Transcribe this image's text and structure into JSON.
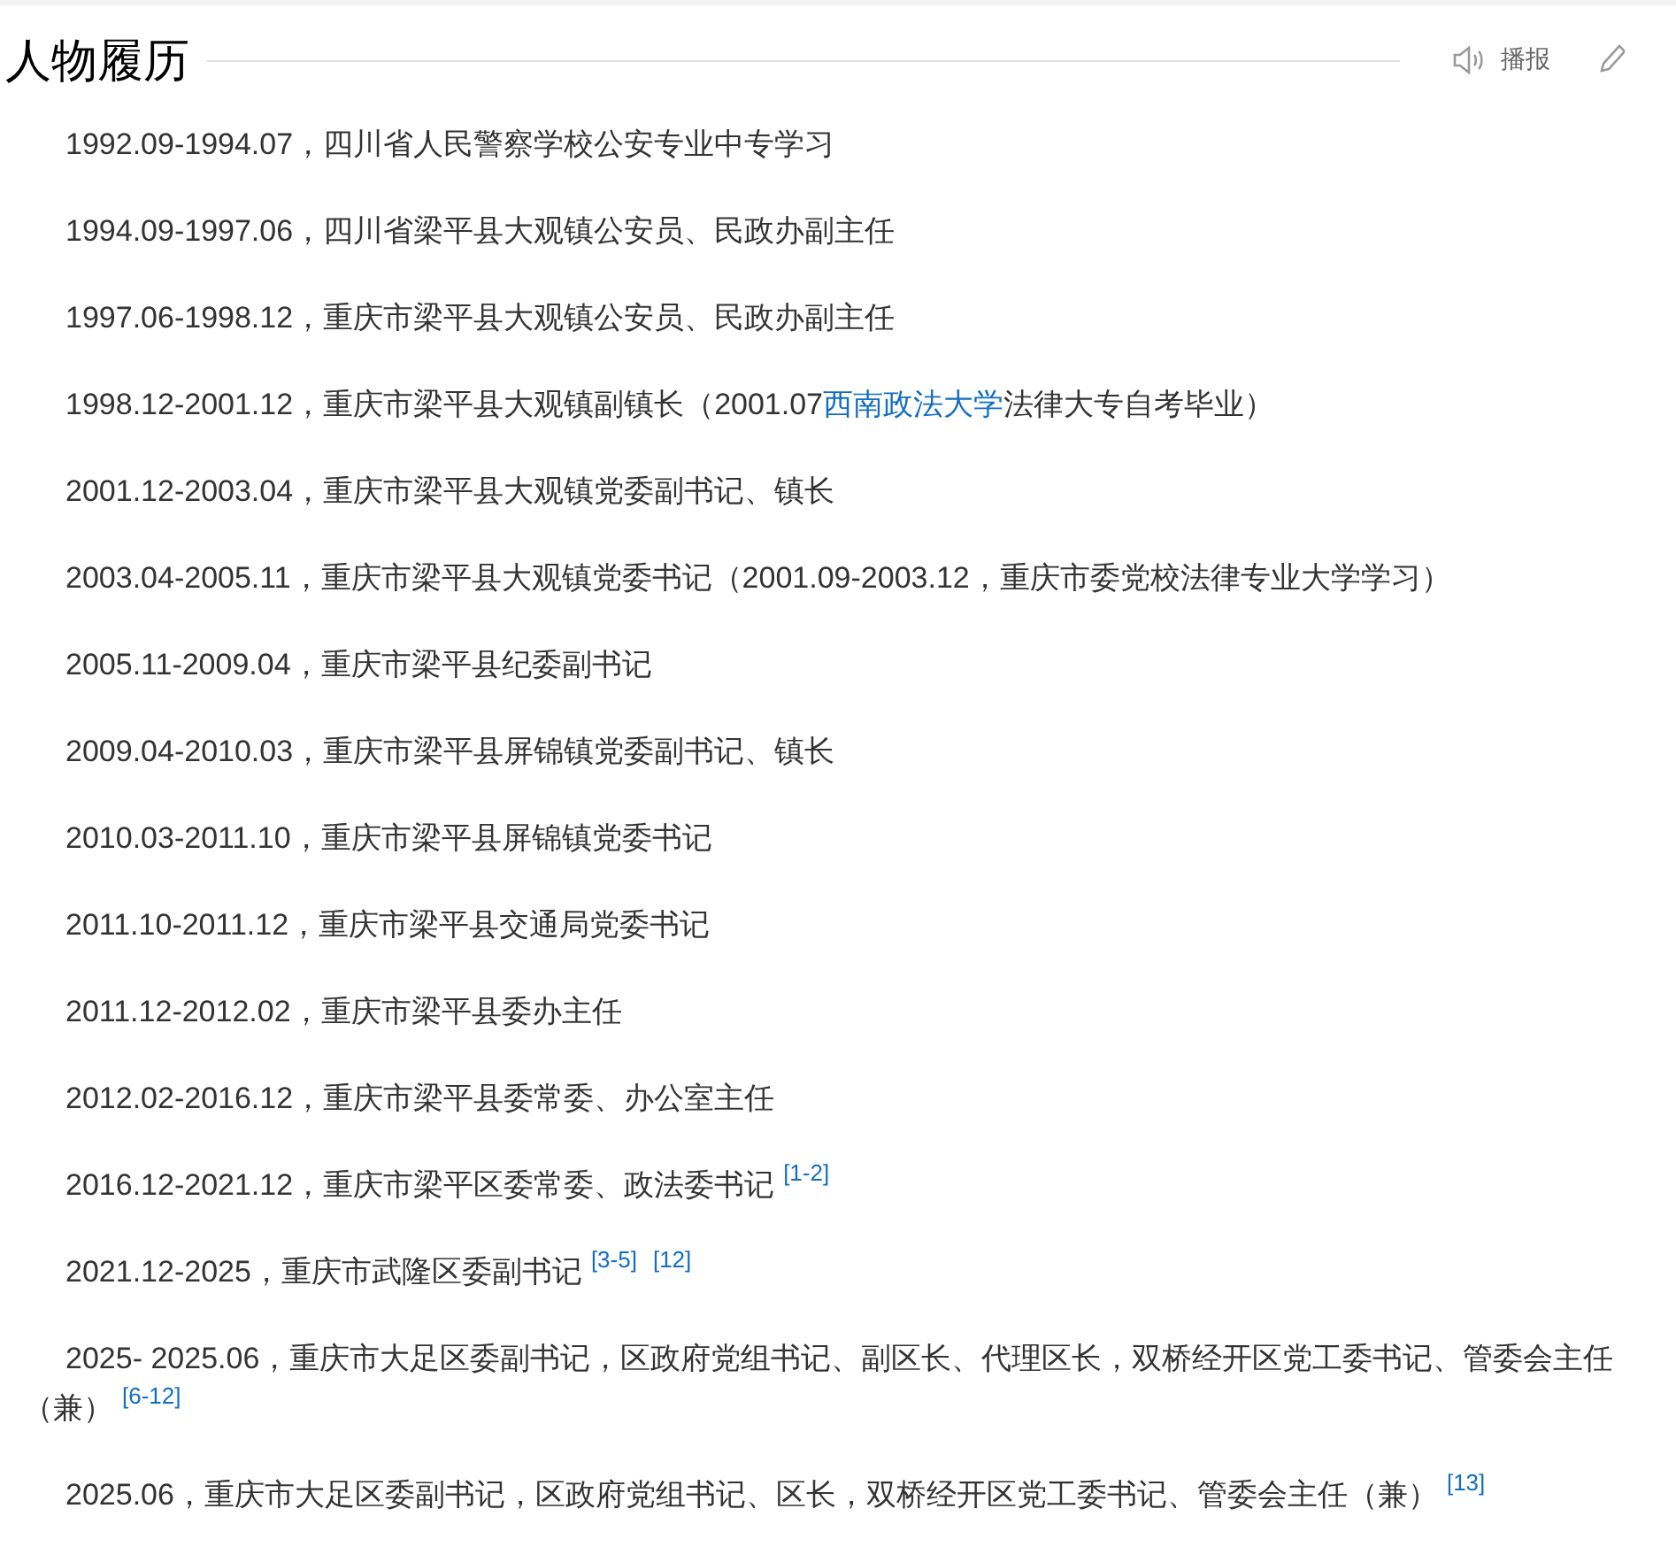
{
  "section": {
    "title": "人物履历",
    "actions": [
      {
        "kind": "speaker",
        "label": "播报"
      },
      {
        "kind": "edit"
      }
    ]
  },
  "paragraphs": [
    {
      "segments": [
        {
          "kind": "text",
          "text": "1992.09-1994.07，四川省人民警察学校公安专业中专学习"
        }
      ]
    },
    {
      "segments": [
        {
          "kind": "text",
          "text": "1994.09-1997.06，四川省梁平县大观镇公安员、民政办副主任"
        }
      ]
    },
    {
      "segments": [
        {
          "kind": "text",
          "text": "1997.06-1998.12，重庆市梁平县大观镇公安员、民政办副主任"
        }
      ]
    },
    {
      "segments": [
        {
          "kind": "text",
          "text": "1998.12-2001.12，重庆市梁平县大观镇副镇长（2001.07"
        },
        {
          "kind": "link",
          "text": "西南政法大学"
        },
        {
          "kind": "text",
          "text": "法律大专自考毕业）"
        }
      ]
    },
    {
      "segments": [
        {
          "kind": "text",
          "text": "2001.12-2003.04，重庆市梁平县大观镇党委副书记、镇长"
        }
      ]
    },
    {
      "segments": [
        {
          "kind": "text",
          "text": "2003.04-2005.11，重庆市梁平县大观镇党委书记（2001.09-2003.12，重庆市委党校法律专业大学学习）"
        }
      ]
    },
    {
      "segments": [
        {
          "kind": "text",
          "text": "2005.11-2009.04，重庆市梁平县纪委副书记"
        }
      ]
    },
    {
      "segments": [
        {
          "kind": "text",
          "text": "2009.04-2010.03，重庆市梁平县屏锦镇党委副书记、镇长"
        }
      ]
    },
    {
      "segments": [
        {
          "kind": "text",
          "text": "2010.03-2011.10，重庆市梁平县屏锦镇党委书记"
        }
      ]
    },
    {
      "segments": [
        {
          "kind": "text",
          "text": "2011.10-2011.12，重庆市梁平县交通局党委书记"
        }
      ]
    },
    {
      "segments": [
        {
          "kind": "text",
          "text": "2011.12-2012.02，重庆市梁平县委办主任"
        }
      ]
    },
    {
      "segments": [
        {
          "kind": "text",
          "text": "2012.02-2016.12，重庆市梁平县委常委、办公室主任"
        }
      ]
    },
    {
      "segments": [
        {
          "kind": "text",
          "text": "2016.12-2021.12，重庆市梁平区委常委、政法委书记"
        },
        {
          "kind": "ref",
          "text": "[1-2]"
        }
      ]
    },
    {
      "segments": [
        {
          "kind": "text",
          "text": "2021.12-2025，重庆市武隆区委副书记"
        },
        {
          "kind": "ref",
          "text": "[3-5]"
        },
        {
          "kind": "ref",
          "text": "[12]"
        }
      ]
    },
    {
      "segments": [
        {
          "kind": "text",
          "text": "2025- 2025.06，重庆市大足区委副书记，区政府党组书记、副区长、代理区长，双桥经开区党工委书记、管委会主任（兼）"
        },
        {
          "kind": "ref",
          "text": "[6-12]"
        }
      ]
    },
    {
      "segments": [
        {
          "kind": "text",
          "text": "2025.06，重庆市大足区委副书记，区政府党组书记、区长，双桥经开区党工委书记、管委会主任（兼）"
        },
        {
          "kind": "ref",
          "text": "[13]"
        }
      ]
    }
  ]
}
